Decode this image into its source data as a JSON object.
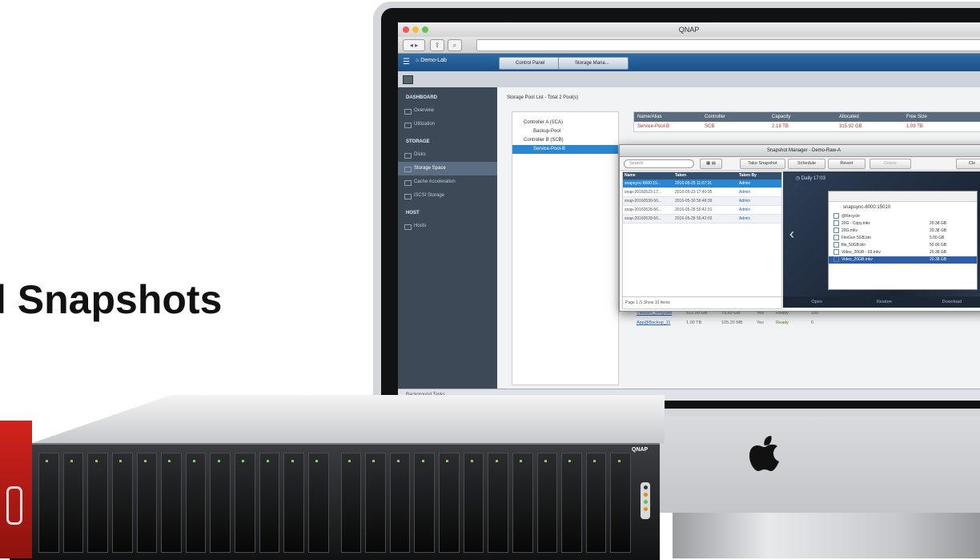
{
  "headline": "l Snapshots",
  "window": {
    "title": "QNAP"
  },
  "app": {
    "home_label": "Demo-Lab",
    "tabs": [
      "Control Panel",
      "Storage Mana..."
    ]
  },
  "sidebar": {
    "sections": [
      {
        "header": "DASHBOARD",
        "items": [
          "Overview",
          "Utilization"
        ]
      },
      {
        "header": "STORAGE",
        "items": [
          "Disks",
          "Storage Space",
          "Cache Acceleration",
          "iSCSI Storage"
        ]
      },
      {
        "header": "HOST",
        "items": [
          "Hosts"
        ]
      }
    ],
    "active_item": "Storage Space"
  },
  "main": {
    "title": "Storage Pool List - Total 2 Pool(s)",
    "tree": [
      "Controller A (SCA)",
      "Backup-Pool",
      "Controller B (SCB)",
      "Service-Pool-B"
    ],
    "pool_table": {
      "columns": [
        "Name/Alias",
        "Controller",
        "Capacity",
        "Allocated",
        "Free Size"
      ],
      "rows": [
        [
          "Service-Pool-B",
          "SCB",
          "2.19 TB",
          "315.92 GB",
          "1.09 TB"
        ]
      ]
    },
    "lower_rows": [
      [
        "VMware_template",
        "512.00 GB",
        "75.60 GB",
        "Yes",
        "Ready",
        "100"
      ],
      [
        "App@Backup_11",
        "1.00 TB",
        "105.20 MB",
        "Yes",
        "Ready",
        "6"
      ]
    ],
    "status": "Background Tasks"
  },
  "dialog": {
    "title": "Snapshot Manager - Demo-Raw-A",
    "search_placeholder": "Search",
    "buttons": [
      "Take Snapshot",
      "Schedule",
      "Revert",
      "Delete",
      "Clo"
    ],
    "columns": [
      "Name",
      "Taken",
      "Taken By"
    ],
    "rows": [
      [
        "snapsync-8000:15...",
        "2016-05-25 11:07:31",
        "Admin"
      ],
      [
        "snap-20160523-17...",
        "2016-05-23 17:40:35",
        "Admin"
      ],
      [
        "snap-20160530-56...",
        "2016-05-30 56:48:39",
        "Admin"
      ],
      [
        "snap-20160528-56...",
        "2016-05-28 56:42:31",
        "Admin"
      ],
      [
        "snap-20160528-56...",
        "2016-05-28 56:42:03",
        "Admin"
      ]
    ],
    "pager": "Page 1 /1   Show 10 Items",
    "preview": {
      "label": "Daily 17:03",
      "folder": "snapsync-8000:15010",
      "files": [
        {
          "name": "@Recycle",
          "size": ""
        },
        {
          "name": "20G - Copy.mkv",
          "size": "20.38 GB"
        },
        {
          "name": "20G.mkv",
          "size": "20.38 GB"
        },
        {
          "name": "FileGen 5GB.bin",
          "size": "5.00 GB"
        },
        {
          "name": "file_50GB.bin",
          "size": "50.00 GB"
        },
        {
          "name": "Video_20GB - 03.mkv",
          "size": "20.38 GB"
        },
        {
          "name": "Video_20GB.mkv",
          "size": "20.38 GB"
        }
      ],
      "actions": [
        "Open",
        "Restore",
        "Download"
      ]
    }
  },
  "device": {
    "brand": "QNAP"
  },
  "colors": {
    "accent": "#1d5187",
    "sidebar": "#3d4956",
    "selection": "#2b86d1",
    "bezel_red": "#d3221c"
  }
}
